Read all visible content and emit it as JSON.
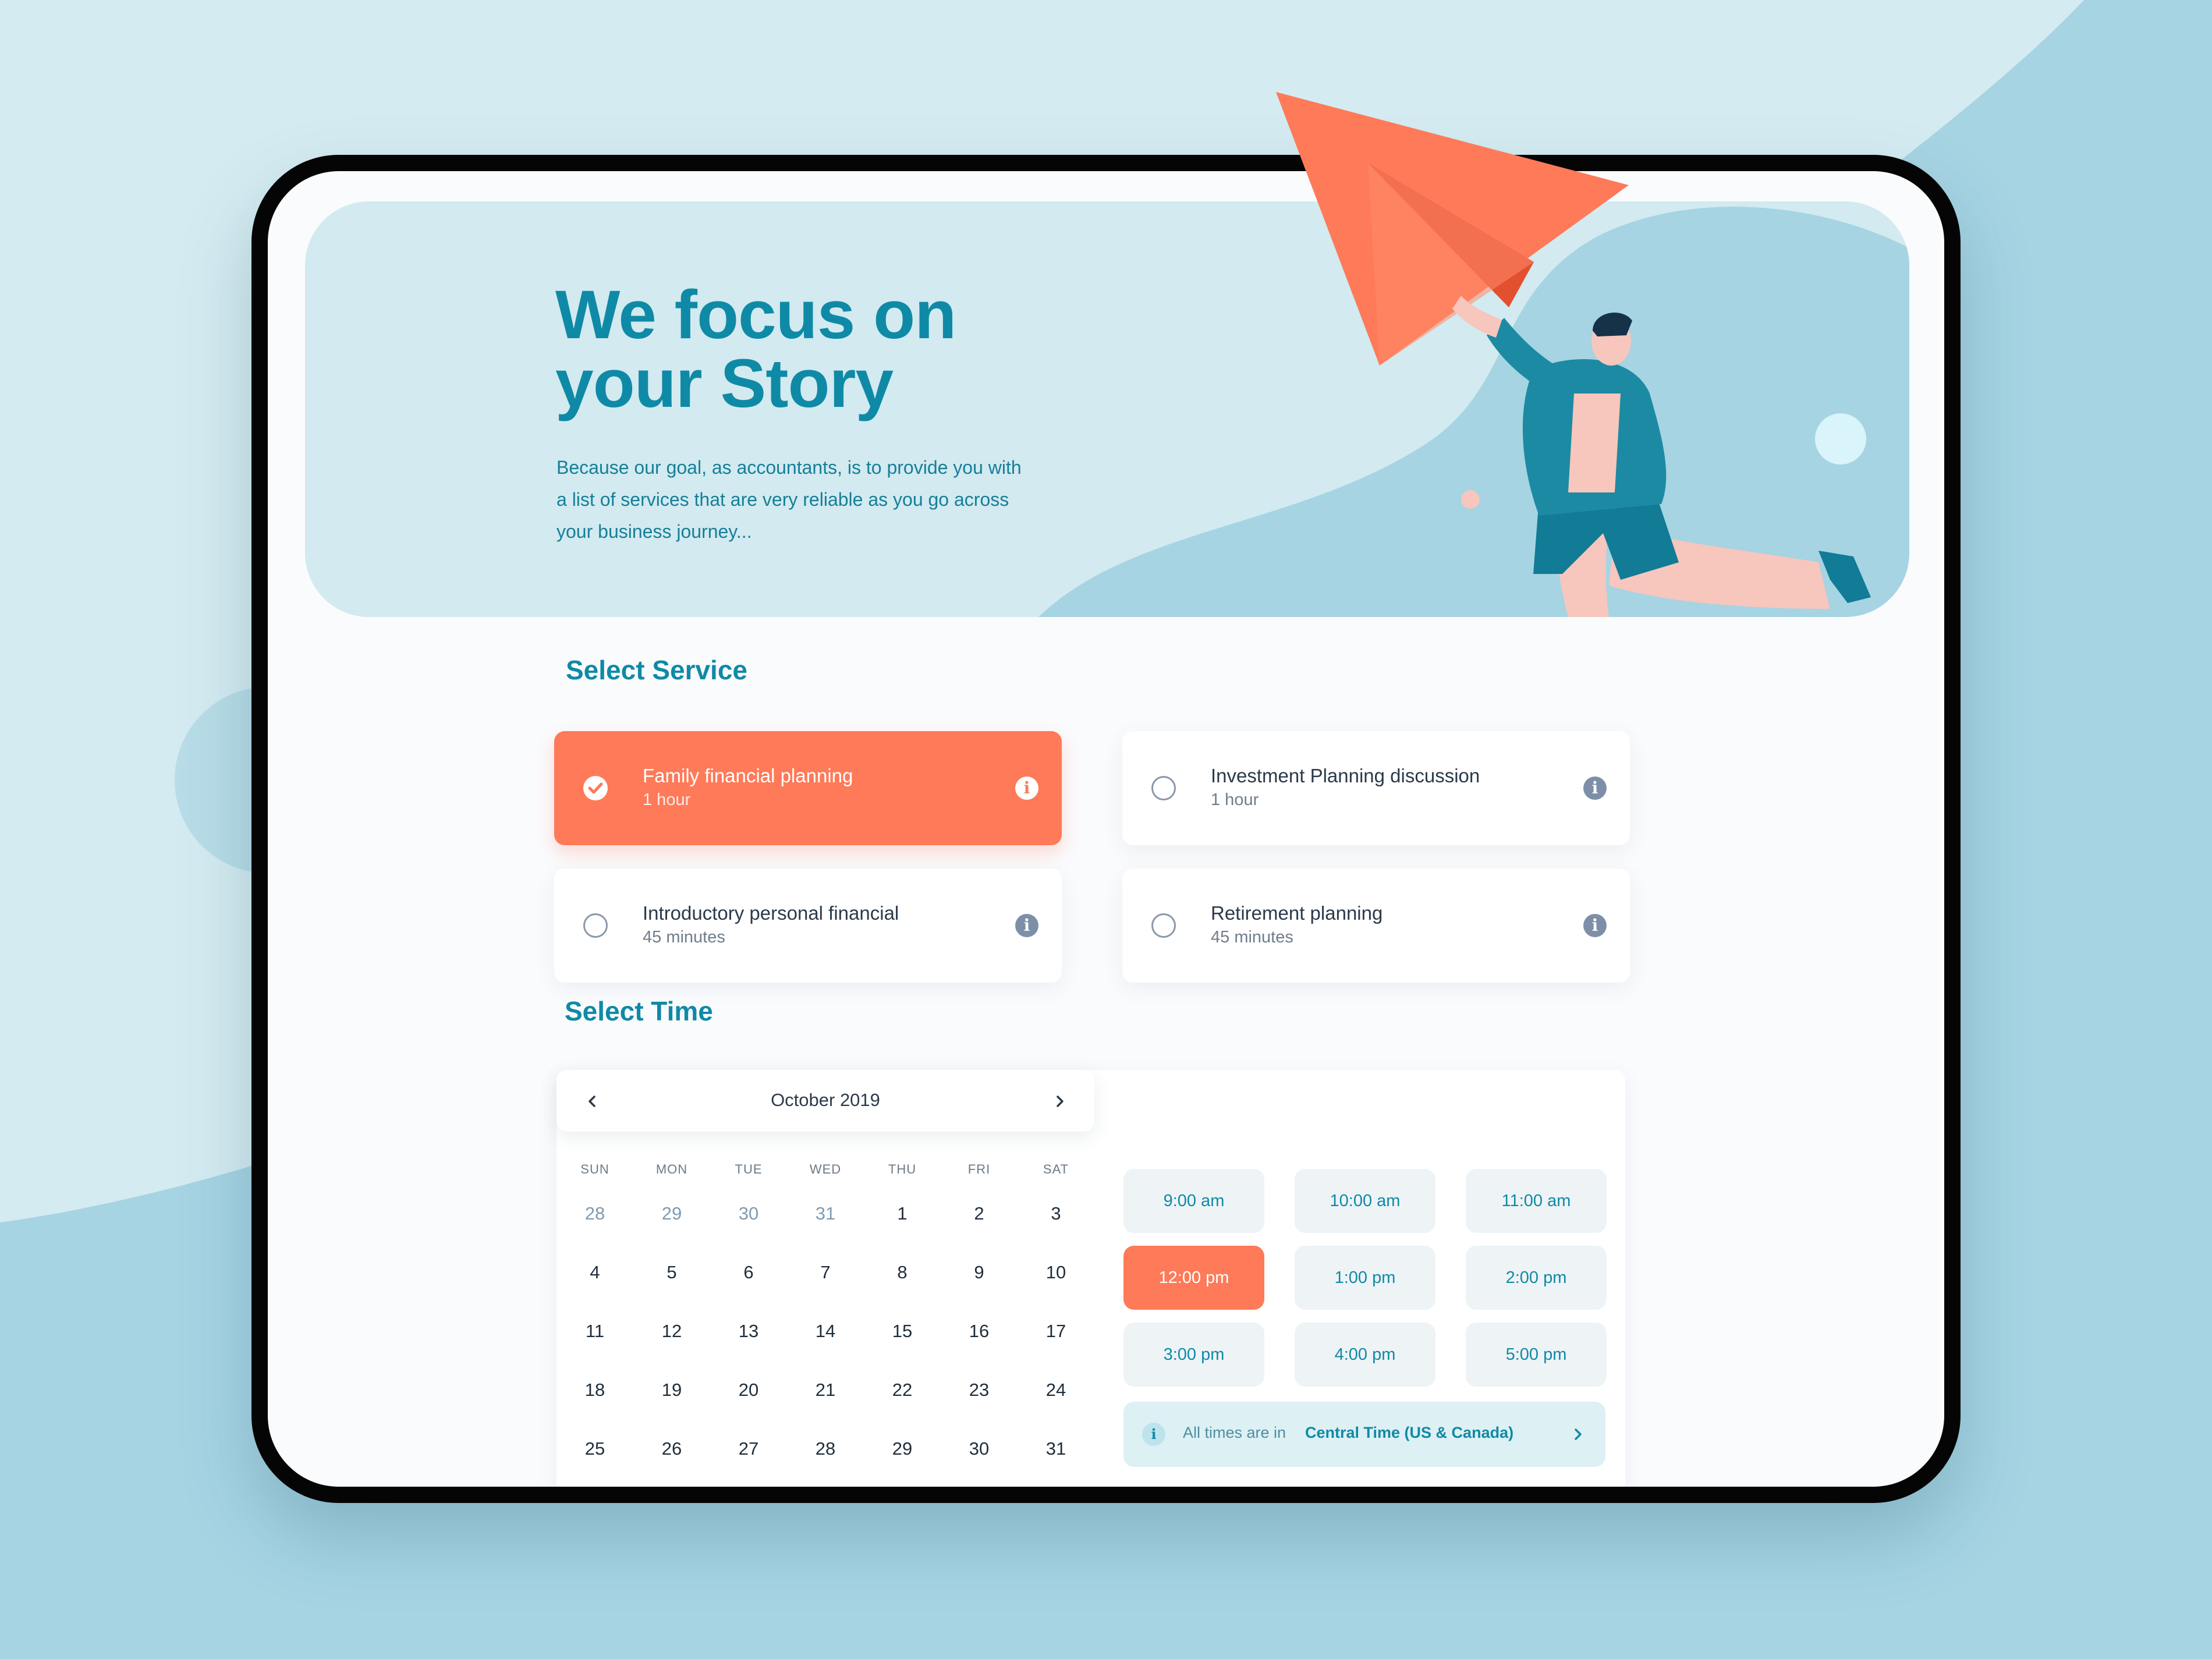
{
  "colors": {
    "accent": "#fe7a58",
    "brand_teal": "#0f8aa6",
    "background_light": "#d4ebf1",
    "background_wave": "#a6d4e3"
  },
  "hero": {
    "title": "We focus on\nyour Story",
    "description": "Because our goal, as accountants, is to provide you with a list of services that are very reliable as you go across your business journey..."
  },
  "services": {
    "title": "Select Service",
    "items": [
      {
        "name": "Family financial planning",
        "duration": "1 hour",
        "selected": true,
        "icon": "check-icon"
      },
      {
        "name": "Investment Planning discussion",
        "duration": "1 hour",
        "selected": false,
        "icon": "radio-icon"
      },
      {
        "name": "Introductory personal financial",
        "duration": "45 minutes",
        "selected": false,
        "icon": "radio-icon"
      },
      {
        "name": "Retirement planning",
        "duration": "45 minutes",
        "selected": false,
        "icon": "radio-icon"
      }
    ]
  },
  "time": {
    "title": "Select Time",
    "calendar": {
      "month": "October 2019",
      "weekdays": [
        "SUN",
        "MON",
        "TUE",
        "WED",
        "THU",
        "FRI",
        "SAT"
      ],
      "weeks": [
        [
          "28",
          "29",
          "30",
          "31",
          "1",
          "2",
          "3"
        ],
        [
          "4",
          "5",
          "6",
          "7",
          "8",
          "9",
          "10"
        ],
        [
          "11",
          "12",
          "13",
          "14",
          "15",
          "16",
          "17"
        ],
        [
          "18",
          "19",
          "20",
          "21",
          "22",
          "23",
          "24"
        ],
        [
          "25",
          "26",
          "27",
          "28",
          "29",
          "30",
          "31"
        ]
      ]
    },
    "slots": [
      {
        "label": "9:00 am",
        "selected": false
      },
      {
        "label": "10:00 am",
        "selected": false
      },
      {
        "label": "11:00 am",
        "selected": false
      },
      {
        "label": "12:00 pm",
        "selected": true
      },
      {
        "label": "1:00 pm",
        "selected": false
      },
      {
        "label": "2:00 pm",
        "selected": false
      },
      {
        "label": "3:00 pm",
        "selected": false
      },
      {
        "label": "4:00 pm",
        "selected": false
      },
      {
        "label": "5:00 pm",
        "selected": false
      }
    ],
    "timezone": {
      "prefix": "All times are in",
      "value": "Central Time (US & Canada)"
    }
  }
}
